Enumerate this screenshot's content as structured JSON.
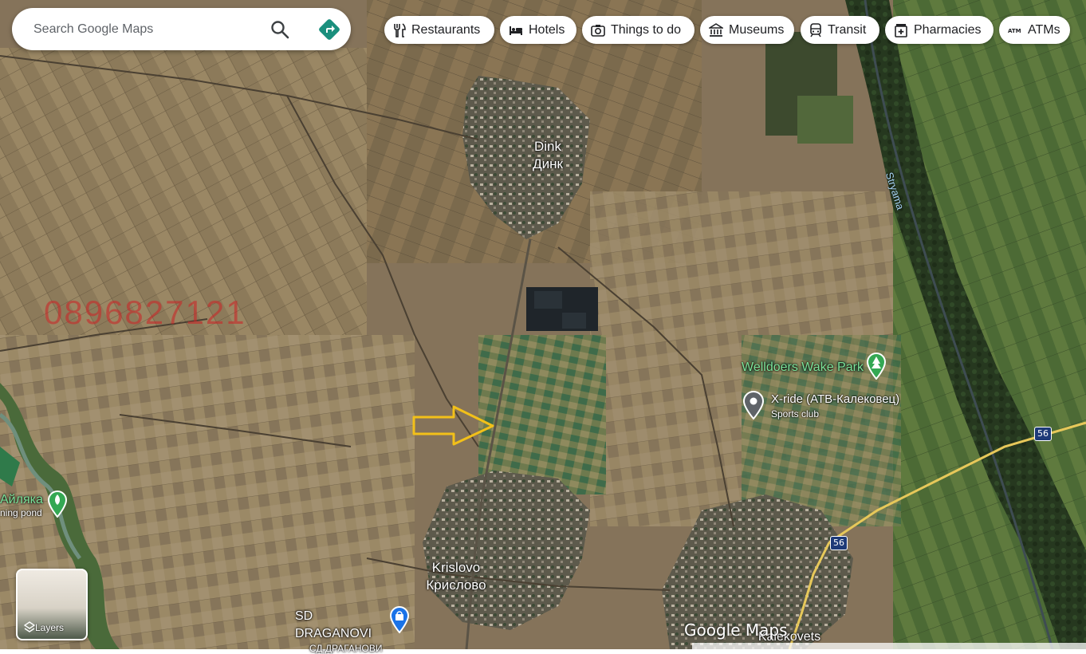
{
  "search": {
    "placeholder": "Search Google Maps"
  },
  "categories": [
    {
      "label": "Restaurants",
      "icon": "restaurant-icon"
    },
    {
      "label": "Hotels",
      "icon": "hotel-icon"
    },
    {
      "label": "Things to do",
      "icon": "camera-icon"
    },
    {
      "label": "Museums",
      "icon": "museum-icon"
    },
    {
      "label": "Transit",
      "icon": "transit-icon"
    },
    {
      "label": "Pharmacies",
      "icon": "pharmacy-icon"
    },
    {
      "label": "ATMs",
      "icon": "atm-icon"
    }
  ],
  "places": {
    "dink": {
      "latin": "Dink",
      "cyrillic": "Динк"
    },
    "krislovo": {
      "latin": "Krislovo",
      "cyrillic": "Крислово"
    },
    "kalekovets": {
      "latin": "Kalekovets"
    },
    "sd_draganovi": {
      "latin": "SD DRAGANOVI",
      "cyrillic": "СД ДРАГАНОВИ"
    },
    "aylyaka": {
      "name": "Айляка",
      "sub": "ning pond"
    }
  },
  "pois": {
    "welldoers": {
      "name": "Welldoers Wake Park"
    },
    "xride": {
      "name": "X-ride (АТВ-Калековец)",
      "category": "Sports club"
    }
  },
  "river": {
    "name": "Stryama"
  },
  "roads": {
    "route_56_a": "56",
    "route_56_b": "56"
  },
  "watermark": {
    "phone": "0896827121"
  },
  "layers": {
    "label": "Layers"
  },
  "branding": {
    "logo": "Google Maps"
  },
  "colors": {
    "accent": "#1a73e8",
    "directions": "#1a8f7d",
    "poi_green": "#34a853",
    "arrow": "#f2c019"
  }
}
